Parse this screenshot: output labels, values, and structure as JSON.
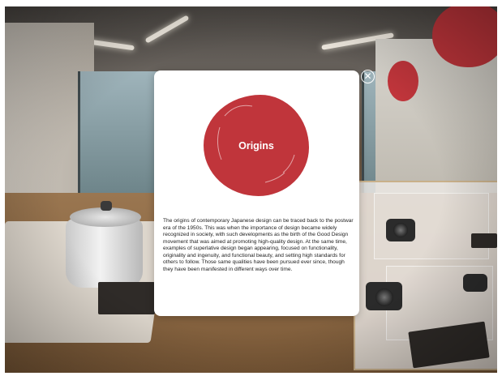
{
  "overlay": {
    "close_icon_glyph": "✕"
  },
  "modal": {
    "title": "Origins",
    "body": "The origins of contemporary Japanese design can be traced back to the postwar era of the 1950s. This was when the importance of design became widely recognized in society, with such developments as the birth of the Good Design movement that was aimed at promoting high-quality design. At the same time, examples of superlative design began appearing, focused on functionality, originality and ingenuity, and functional beauty, and setting high standards for others to follow. Those same qualities have been pursued ever since, though they have been manifested in different ways over time."
  },
  "colors": {
    "accent_red": "#c0353b",
    "modal_bg": "#ffffff",
    "text": "#222222"
  }
}
